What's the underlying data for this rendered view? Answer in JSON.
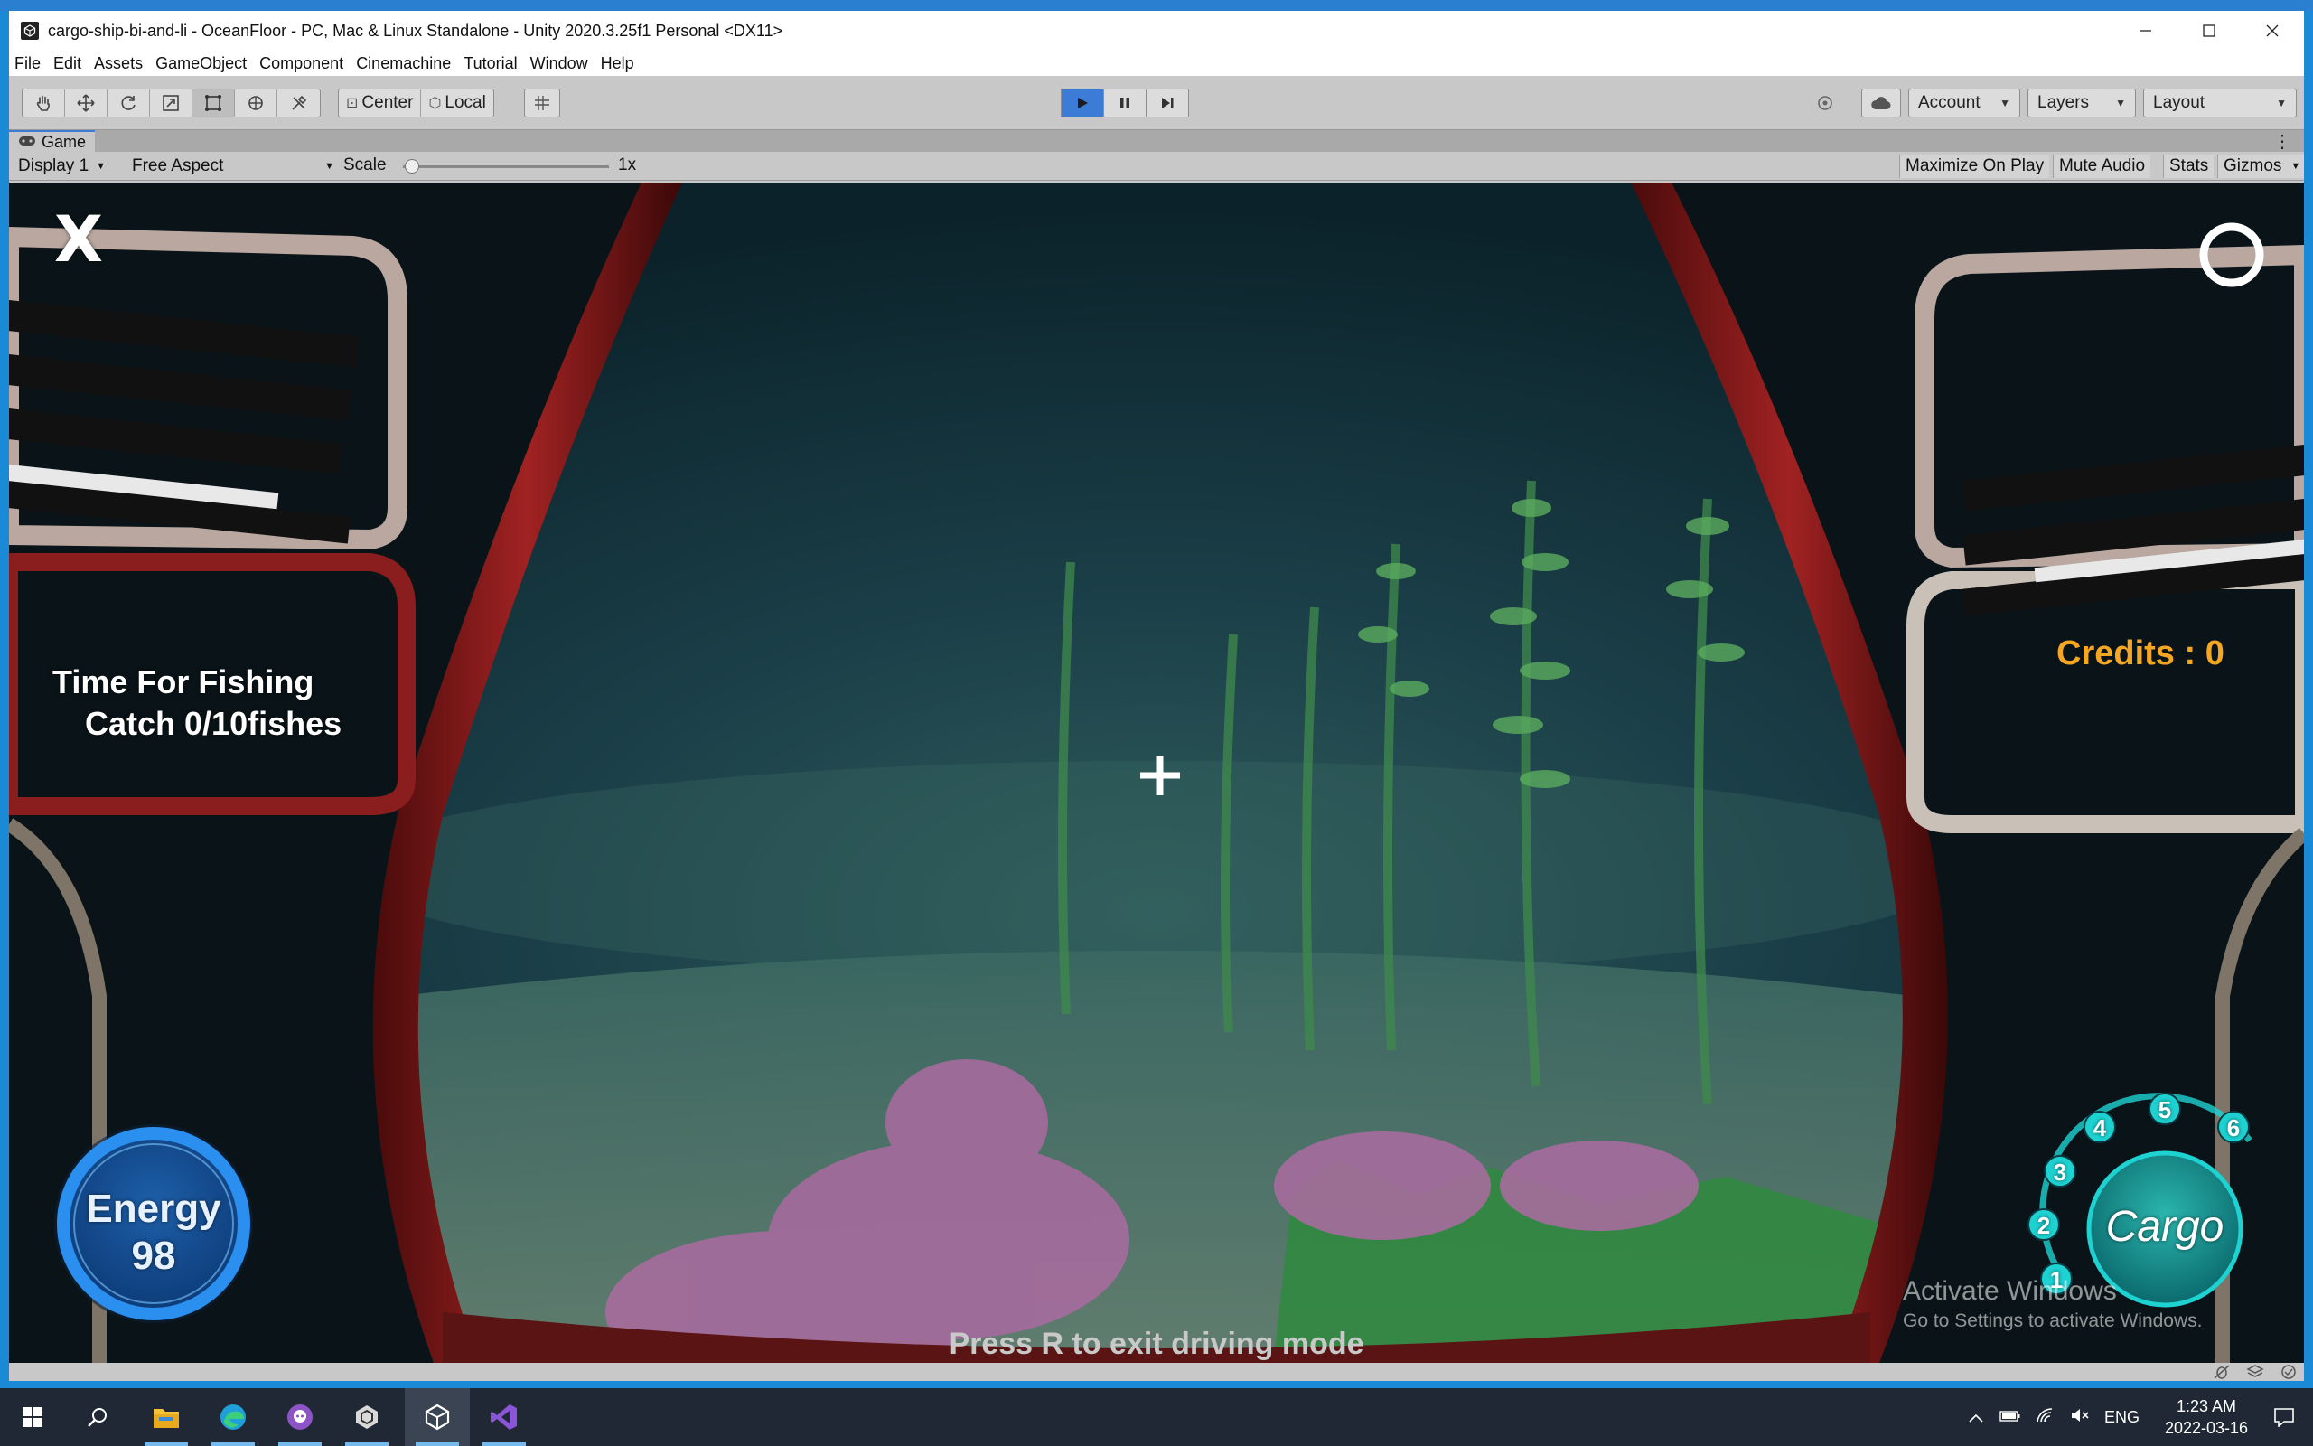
{
  "window": {
    "title": "cargo-ship-bi-and-li - OceanFloor - PC, Mac & Linux Standalone - Unity 2020.3.25f1 Personal <DX11>"
  },
  "menu": [
    "File",
    "Edit",
    "Assets",
    "GameObject",
    "Component",
    "Cinemachine",
    "Tutorial",
    "Window",
    "Help"
  ],
  "toolbar": {
    "pivot_mode": "Center",
    "pivot_space": "Local",
    "account_label": "Account",
    "layers_label": "Layers",
    "layout_label": "Layout"
  },
  "game_view": {
    "tab_label": "Game",
    "display": "Display 1",
    "aspect": "Free Aspect",
    "scale_label": "Scale",
    "scale_value": "1x",
    "maximize_label": "Maximize On Play",
    "mute_label": "Mute Audio",
    "stats_label": "Stats",
    "gizmos_label": "Gizmos"
  },
  "hud": {
    "close_glyph": "X",
    "objective_title": "Time For Fishing",
    "objective_progress": "Catch 0/10fishes",
    "credits": "Credits : 0",
    "energy_label": "Energy",
    "energy_value": "98",
    "cargo_label": "Cargo",
    "cargo_slots": [
      "1",
      "2",
      "3",
      "4",
      "5",
      "6"
    ],
    "hint": "Press R to exit driving mode"
  },
  "watermark": {
    "line1": "Activate Windows",
    "line2": "Go to Settings to activate Windows."
  },
  "taskbar": {
    "language": "ENG",
    "time": "1:23 AM",
    "date": "2022-03-16"
  },
  "colors": {
    "credits": "#f5a623",
    "energy_ring": "#2b8ff0",
    "cargo_ring": "#1ed2d2",
    "play_active": "#3d7cd6"
  }
}
